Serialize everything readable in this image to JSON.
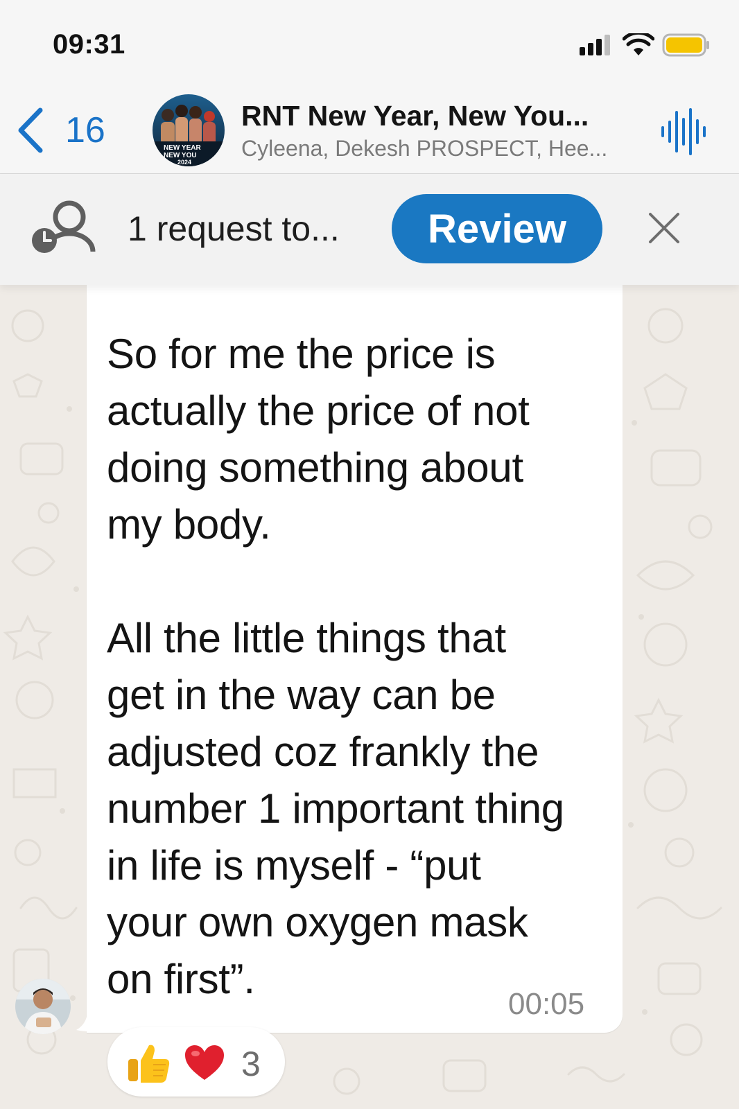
{
  "status_bar": {
    "time": "09:31"
  },
  "header": {
    "back_count": "16",
    "title": "RNT New Year, New You...",
    "subtitle": "Cyleena, Dekesh PROSPECT, Hee...",
    "avatar_text_line1": "NEW YEAR",
    "avatar_text_line2": "NEW YOU",
    "avatar_text_line3": "2024"
  },
  "banner": {
    "request_text": "1 request to...",
    "review_label": "Review"
  },
  "message": {
    "text": "So for me the price is\nactually the price of not\ndoing something about\nmy body.\n\nAll the little things that\nget in the way can be\nadjusted coz frankly the\nnumber 1 important thing\nin life is myself - “put\nyour own oxygen mask\non first”.",
    "time": "00:05"
  },
  "reactions": {
    "emojis": [
      "thumbs-up",
      "red-heart"
    ],
    "count": "3"
  },
  "colors": {
    "accent": "#1a78c2",
    "wallpaper": "#efebe6",
    "bubble": "#ffffff"
  }
}
